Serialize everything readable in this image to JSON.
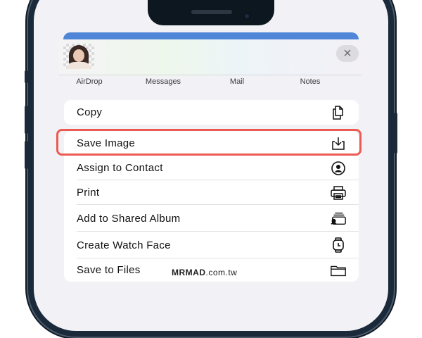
{
  "share_sheet": {
    "close_symbol": "×",
    "apps": [
      {
        "label": "AirDrop"
      },
      {
        "label": "Messages"
      },
      {
        "label": "Mail"
      },
      {
        "label": "Notes"
      }
    ]
  },
  "actions": {
    "copy": {
      "label": "Copy",
      "icon": "copy-icon"
    },
    "save_image": {
      "label": "Save Image",
      "icon": "save-icon",
      "highlighted": true,
      "highlight_color": "#ec5b53"
    },
    "assign_contact": {
      "label": "Assign to Contact",
      "icon": "contact-icon"
    },
    "print": {
      "label": "Print",
      "icon": "printer-icon"
    },
    "shared_album": {
      "label": "Add to Shared Album",
      "icon": "shared-album-icon"
    },
    "watch_face": {
      "label": "Create Watch Face",
      "icon": "watch-icon"
    },
    "save_files": {
      "label": "Save to Files",
      "icon": "folder-icon"
    }
  },
  "watermark": {
    "brand": "MRMAD",
    "domain": ".com.tw"
  },
  "colors": {
    "accent_strip": "#4f86d8",
    "sheet_bg": "#f2f2f6",
    "frame": "#1b2a3a"
  }
}
